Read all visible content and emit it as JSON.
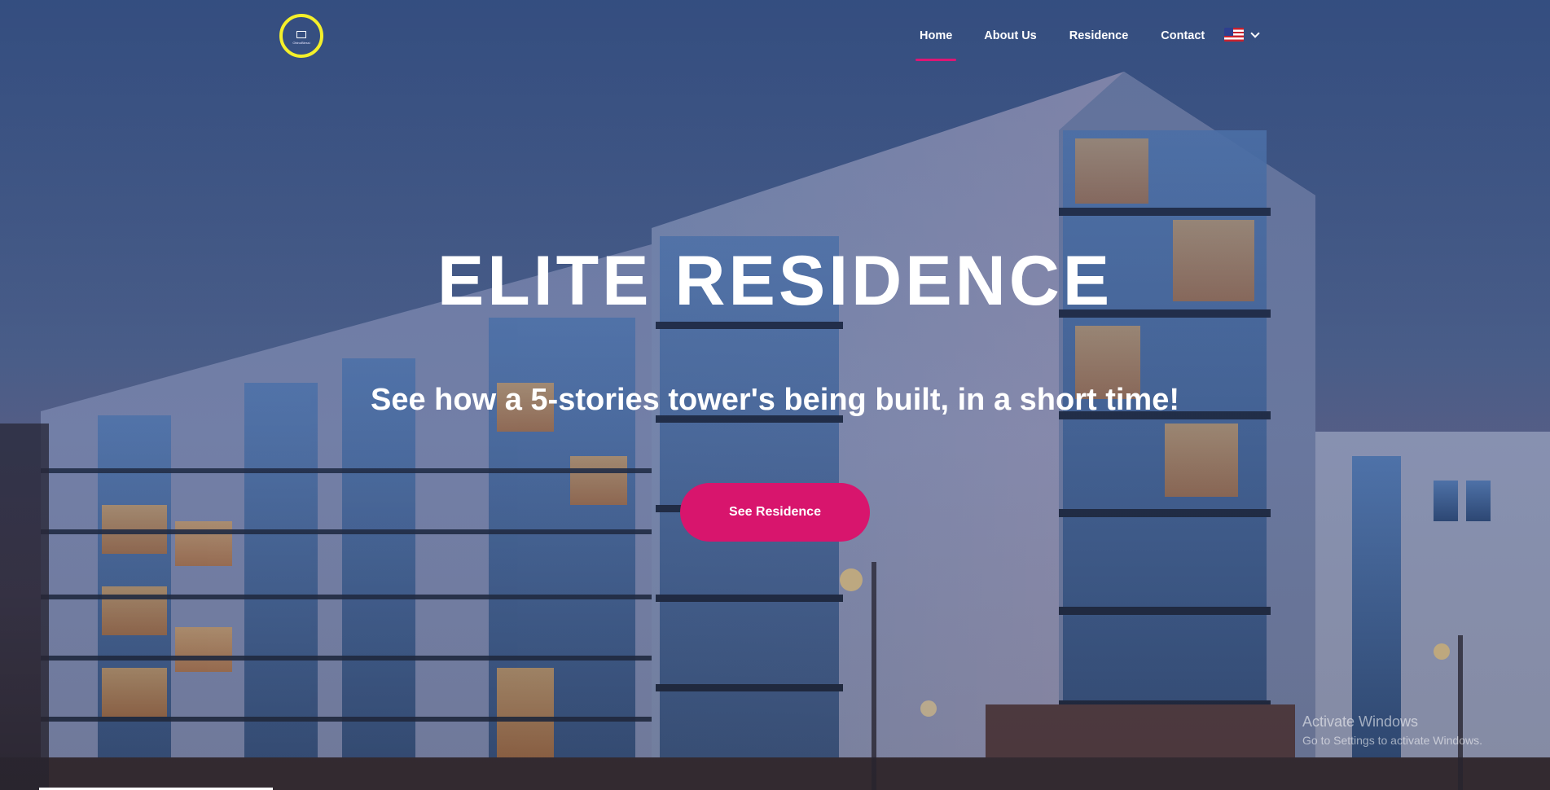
{
  "nav": {
    "logo_text": "ObinoBlessi",
    "items": [
      {
        "label": "Home",
        "active": true
      },
      {
        "label": "About Us",
        "active": false
      },
      {
        "label": "Residence",
        "active": false
      },
      {
        "label": "Contact",
        "active": false
      }
    ],
    "language_icon": "us-flag-icon"
  },
  "hero": {
    "title": "ELITE RESIDENCE",
    "subtitle": "See how a 5-stories tower's being built, in a short time!",
    "cta_label": "See Residence"
  },
  "watermark": {
    "line1": "Activate Windows",
    "line2": "Go to Settings to activate Windows."
  },
  "colors": {
    "accent": "#d8156d",
    "logo_ring": "#f4f02a",
    "sky": "#3a5687"
  }
}
